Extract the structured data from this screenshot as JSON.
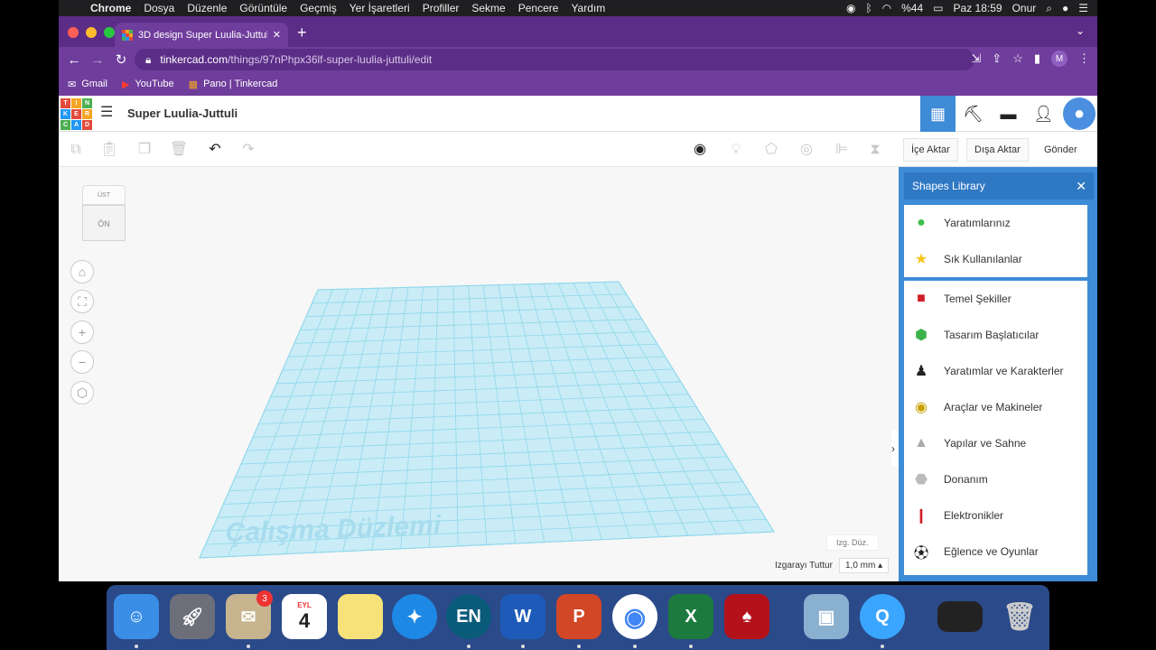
{
  "menubar": {
    "app": "Chrome",
    "items": [
      "Dosya",
      "Düzenle",
      "Görüntüle",
      "Geçmiş",
      "Yer İşaretleri",
      "Profiller",
      "Sekme",
      "Pencere",
      "Yardım"
    ],
    "battery": "%44",
    "datetime": "Paz 18:59",
    "user": "Onur"
  },
  "browser": {
    "tab_title": "3D design Super Luulia-Juttuli",
    "url_host": "tinkercad.com",
    "url_path": "/things/97nPhpx36lf-super-luulia-juttuli/edit",
    "profile_initial": "M",
    "bookmarks": [
      "Gmail",
      "YouTube",
      "Pano | Tinkercad"
    ]
  },
  "tinkercad": {
    "logo_letters": [
      "T",
      "I",
      "N",
      "K",
      "E",
      "R",
      "C",
      "A",
      "D"
    ],
    "design_name": "Super Luulia-Juttuli",
    "import_label": "İçe Aktar",
    "export_label": "Dışa Aktar",
    "send_label": "Gönder",
    "viewcube_top": "ÜST",
    "viewcube_front": "ÖN",
    "workplane_label": "Çalışma Düzlemi",
    "edit_grid": "Izg. Düz.",
    "snap_grid_label": "Izgarayı Tuttur",
    "snap_grid_value": "1,0 mm ▴"
  },
  "shapes_library": {
    "title": "Shapes Library",
    "items_top": [
      {
        "label": "Yaratımlarınız",
        "icon": "person-icon"
      },
      {
        "label": "Sık Kullanılanlar",
        "icon": "star-icon"
      }
    ],
    "items": [
      {
        "label": "Temel Şekiller",
        "icon": "red-cube-icon"
      },
      {
        "label": "Tasarım Başlatıcılar",
        "icon": "green-blob-icon"
      },
      {
        "label": "Yaratımlar ve Karakterler",
        "icon": "penguin-icon"
      },
      {
        "label": "Araçlar ve Makineler",
        "icon": "wheel-icon"
      },
      {
        "label": "Yapılar ve Sahne",
        "icon": "rock-icon"
      },
      {
        "label": "Donanım",
        "icon": "nut-icon"
      },
      {
        "label": "Elektronikler",
        "icon": "led-icon"
      },
      {
        "label": "Eğlence ve Oyunlar",
        "icon": "soccer-ball-icon"
      }
    ]
  },
  "dock": {
    "mail_badge": "3",
    "calendar_month": "EYL",
    "calendar_day": "4",
    "en_label": "EN",
    "word_label": "W",
    "ppt_label": "P",
    "excel_label": "X"
  }
}
